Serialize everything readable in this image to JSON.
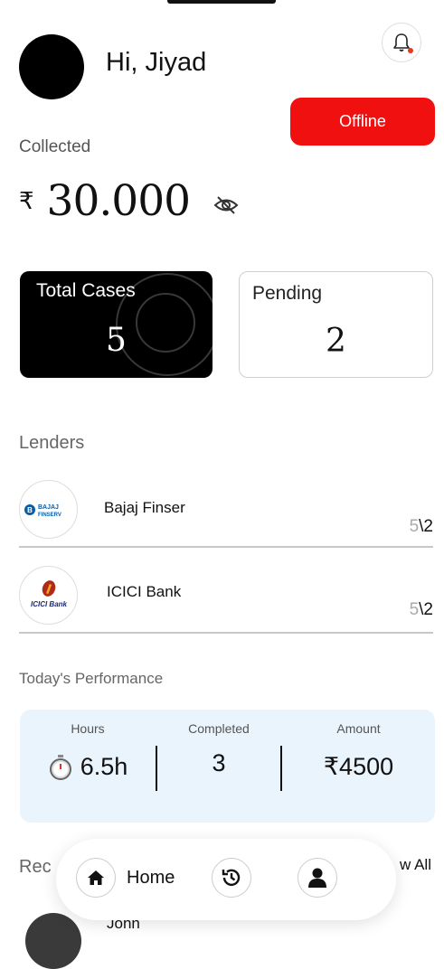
{
  "header": {
    "greeting": "Hi, Jiyad",
    "status_button": "Offline",
    "notification_icon": "bell-icon"
  },
  "collected": {
    "label": "Collected",
    "currency": "₹",
    "amount": "30.000"
  },
  "stats": {
    "total_cases_label": "Total Cases",
    "total_cases_value": "5",
    "pending_label": "Pending",
    "pending_value": "2"
  },
  "lenders": {
    "title": "Lenders",
    "items": [
      {
        "name": "Bajaj Finser",
        "count_dim": "5",
        "count_rest": "\\2",
        "logo_text_top": "BAJAJ",
        "logo_text_bottom": "FINSERV"
      },
      {
        "name": "ICICI Bank",
        "count_dim": "5",
        "count_rest": "\\2",
        "logo_text": "ICICI Bank"
      }
    ]
  },
  "performance": {
    "title": "Today's Performance",
    "hours_label": "Hours",
    "hours_value": "6.5h",
    "completed_label": "Completed",
    "completed_value": "3",
    "amount_label": "Amount",
    "amount_value": "₹4500"
  },
  "recent": {
    "title": "Rec",
    "view_all": "w All",
    "first_name": "John"
  },
  "nav": {
    "home_label": "Home"
  },
  "colors": {
    "status_red": "#f01010",
    "perf_bg": "#eaf4fd",
    "bajaj_blue": "#0a5ea8",
    "icici_red": "#b02a1a"
  }
}
